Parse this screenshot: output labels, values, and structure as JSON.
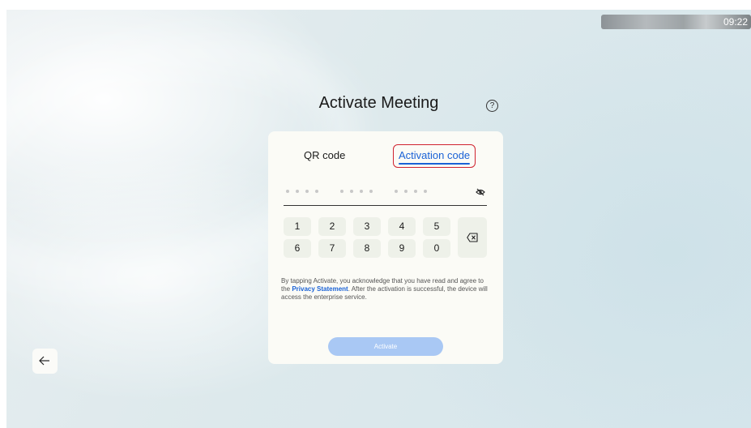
{
  "status_bar": {
    "time": "09:22"
  },
  "header": {
    "title": "Activate Meeting",
    "help_icon": "question-circle-icon"
  },
  "tabs": [
    {
      "label": "QR code",
      "active": false
    },
    {
      "label": "Activation code",
      "active": true
    }
  ],
  "code_input": {
    "value": "",
    "masked_groups": 3,
    "visibility_icon": "eye-off-icon"
  },
  "keypad": {
    "keys": [
      "1",
      "2",
      "3",
      "4",
      "5",
      "6",
      "7",
      "8",
      "9",
      "0"
    ],
    "backspace_icon": "backspace-icon"
  },
  "disclaimer": {
    "before_link": "By tapping Activate, you acknowledge that you have read and agree to the ",
    "link_text": "Privacy Statement",
    "after_link": ". After the activation is successful, the device will access the enterprise service."
  },
  "activate_button": {
    "label": "Activate",
    "enabled": false
  },
  "navigation": {
    "back_icon": "arrow-left-icon"
  },
  "colors": {
    "accent": "#1a62d6",
    "highlight": "#d0232f",
    "button_disabled": "#a9c8f4"
  }
}
